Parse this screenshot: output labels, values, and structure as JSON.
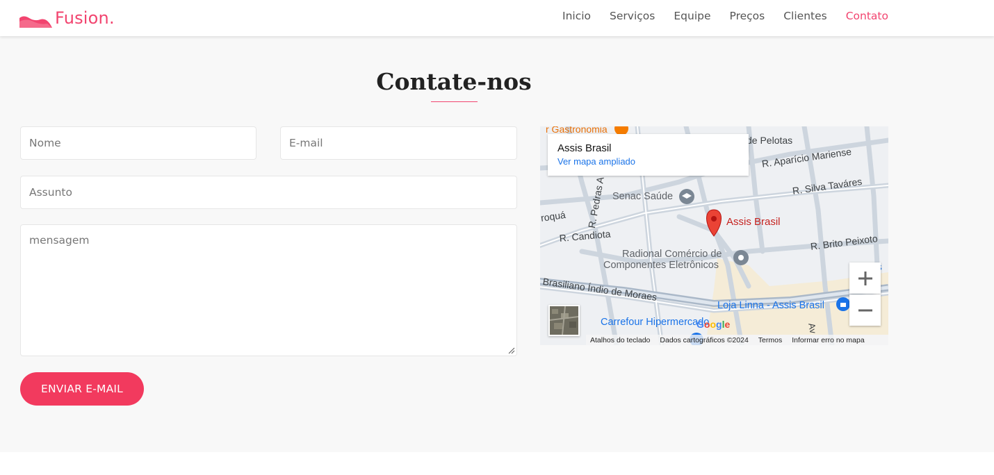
{
  "brand": {
    "name": "Fusion.",
    "color": "#f2446f"
  },
  "nav": {
    "items": [
      "Inicio",
      "Serviços",
      "Equipe",
      "Preços",
      "Clientes",
      "Contato"
    ],
    "active": "Contato"
  },
  "contact": {
    "title": "Contate-nos",
    "placeholders": {
      "name": "Nome",
      "email": "E-mail",
      "subject": "Assunto",
      "message": "mensagem"
    },
    "send_label": "ENVIAR E-MAIL",
    "accent": "#f23a5e"
  },
  "map": {
    "card_title": "Assis Brasil",
    "card_link": "Ver mapa ampliado",
    "marker_label": "Assis Brasil",
    "labels": {
      "gastronomia": "r Gastronomia",
      "pelotas": "de Pelotas",
      "aparicio": "R. Aparício Mariense",
      "silva": "R. Silva Taváres",
      "senac": "Senac Saúde",
      "pedras": "R. Pedras A",
      "roqua": "roquá",
      "candiota": "R. Candiota",
      "radional1": "Radional Comércio de",
      "radional2": "Componentes Eletrônicos",
      "brito": "R. Brito Peixoto",
      "brasiliano": "Brasiliano Índio de Moraes",
      "linna": "Loja Linna - Assis Brasil",
      "carrefour": "Carrefour Hipermercado",
      "as": "as",
      "av": "Av"
    },
    "footer": [
      "Atalhos do teclado",
      "Dados cartográficos ©2024",
      "Termos",
      "Informar erro no mapa"
    ],
    "google": "Google"
  }
}
